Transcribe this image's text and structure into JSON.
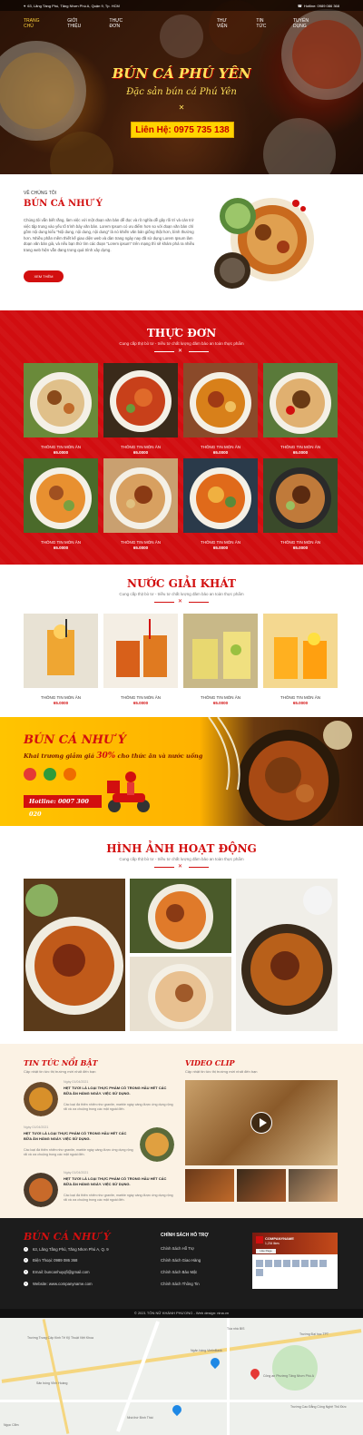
{
  "topbar": {
    "address": "63, Lãng Tầng Phú, Tăng Nhơn Phú A, Quận 9, Tp. HCM",
    "hotline": "Hotline: 0989 086 368"
  },
  "nav": {
    "items": [
      "Trang chủ",
      "Giới thiệu",
      "Thực đơn",
      "Thư viện",
      "Tin tức",
      "Tuyển dụng"
    ],
    "active_index": 0
  },
  "hero": {
    "title": "BÚN CÁ PHÚ YÊN",
    "subtitle": "Đặc sản bún cá Phú Yên",
    "phone": "Liên Hệ: 0975 735 138"
  },
  "about": {
    "kicker": "VỀ CHÚNG TÔI",
    "title": "BÚN CÁ NHƯ Ý",
    "text": "Chúng tôi vẫn biết rằng, làm việc với một đoạn văn bản dễ đọc và rõ nghĩa dễ gây rối trí và cản trở việc tập trung vào yếu tố trình bày văn bản. Lorem Ipsum có ưu điểm hơn so với đoạn văn bản chỉ gồm nội dung kiểu \"Nội dung, nội dung, nội dung\" là nó khiến văn bản giống thật hơn, bình thường hơn. Nhiều phần mềm thiết kế giao diện web và dàn trang ngày nay đã sử dụng Lorem Ipsum làm đoạn văn bản giả, và nếu bạn thử tìm các đoạn \"Lorem ipsum\" trên mạng thì sẽ khám phá ra nhiều trang web hiện vẫn đang trong quá trình xây dựng.",
    "button": "XEM THÊM"
  },
  "menu": {
    "title": "THỰC ĐƠN",
    "subtitle": "Cung cấp thịt bò tơ - triều tơ chất lượng đảm bảo an toàn thực phẩm",
    "items": [
      {
        "name": "THÔNG TIN MÓN ĂN",
        "price": "65.0000"
      },
      {
        "name": "THÔNG TIN MÓN ĂN",
        "price": "65.0000"
      },
      {
        "name": "THÔNG TIN MÓN ĂN",
        "price": "65.0000"
      },
      {
        "name": "THÔNG TIN MÓN ĂN",
        "price": "65.0000"
      },
      {
        "name": "THÔNG TIN MÓN ĂN",
        "price": "65.0000"
      },
      {
        "name": "THÔNG TIN MÓN ĂN",
        "price": "65.0000"
      },
      {
        "name": "THÔNG TIN MÓN ĂN",
        "price": "65.0000"
      },
      {
        "name": "THÔNG TIN MÓN ĂN",
        "price": "65.0000"
      }
    ]
  },
  "drinks": {
    "title": "NƯỚC GIẢI KHÁT",
    "subtitle": "Cung cấp thịt bò tơ - triều tơ chất lượng đảm bảo an toàn thực phẩm",
    "items": [
      {
        "name": "THÔNG TIN MÓN ĂN",
        "price": "65.0000"
      },
      {
        "name": "THÔNG TIN MÓN ĂN",
        "price": "65.0000"
      },
      {
        "name": "THÔNG TIN MÓN ĂN",
        "price": "65.0000"
      },
      {
        "name": "THÔNG TIN MÓN ĂN",
        "price": "65.0000"
      }
    ]
  },
  "promo": {
    "title": "BÚN CÁ NHƯ Ý",
    "text_before": "Khai trương giảm giá",
    "percent": "30%",
    "text_after": "cho thức ăn và nước uống",
    "hotline": "Hotline: 0007 300 020"
  },
  "activities": {
    "title": "HÌNH ẢNH HOẠT ĐỘNG",
    "subtitle": "Cung cấp thịt bò tơ - triều tơ chất lượng đảm bảo an toàn thực phẩm"
  },
  "news": {
    "title": "TIN TỨC NỔI BẬT",
    "subtitle": "Cập nhật tin tức thị trường mới nhất đến bạn",
    "items": [
      {
        "date": "Ngày 01/04/2021",
        "headline": "HẸT TƯƠI LÀ LOẠI THỰC PHẨM CÓ TRONG HẦU HẾT CÁC BỮA ĂN HẰNG NGÀY. VIỆC SỬ DỤNG.",
        "desc": "Các loại đá thiên nhiên như granite, marble ngày càng được ứng dụng rộng rãi và ưa chuộng trong các mặt ngoài đến."
      },
      {
        "date": "Ngày 01/04/2021",
        "headline": "HẸT TƯƠI LÀ LOẠI THỰC PHẨM CÓ TRONG HẦU HẾT CÁC BỮA ĂN HẰNG NGÀY. VIỆC SỬ DỤNG.",
        "desc": "Các loại đá thiên nhiên như granite, marble ngày càng được ứng dụng rộng rãi và ưa chuộng trong các mặt ngoài đến."
      },
      {
        "date": "Ngày 01/04/2021",
        "headline": "HẸT TƯƠI LÀ LOẠI THỰC PHẨM CÓ TRONG HẦU HẾT CÁC BỮA ĂN HẰNG NGÀY. VIỆC SỬ DỤNG.",
        "desc": "Các loại đá thiên nhiên như granite, marble ngày càng được ứng dụng rộng rãi và ưa chuộng trong các mặt ngoài đến."
      }
    ]
  },
  "video": {
    "title": "VIDEO CLIP",
    "subtitle": "Cập nhật tin tức thị trường mới nhất đến bạn"
  },
  "footer": {
    "logo": "BÚN CÁ NHƯ Ý",
    "address": "63, Lãng Tầng Phú, Tăng Nhơn Phú A, Q. 9",
    "phone": "Điện Thoại: 0989 086 368",
    "email": "Email: buncanhuyqfi@gmail.com",
    "website": "Website: www.companyname.com",
    "policy_title": "CHÍNH SÁCH HỖ TRỢ",
    "policies": [
      "Chính Sách Hỗ Trợ",
      "Chính Sách Giao Hàng",
      "Chính Sách Bảo Mật",
      "Chính Sách Thông Tin"
    ],
    "fb_name": "COMPANYNAME",
    "fb_likes": "1,234 likes",
    "fb_button": "Like Page",
    "copyright": "© 2021 TÔN NỮ KHÁNH PHƯƠNG - Web design: nina.vn"
  },
  "map": {
    "labels": [
      "Tòa nhà BIS",
      "Trường Trung Cấp Kinh Tế Kỹ Thuật Việt Khoa",
      "Công an Phường Tăng Nhơn Phú A",
      "Trường Cao Đẳng Công Nghệ Thủ Đức",
      "Sân bóng Vĩnh Hoàng",
      "Ngân hàng VietinBank",
      "Trường Đại học TPT",
      "Nhà thờ Bình Thái",
      "Ngọc Cẩm"
    ]
  },
  "colors": {
    "brand_red": "#d20f0f",
    "accent_yellow": "#ffd400"
  }
}
